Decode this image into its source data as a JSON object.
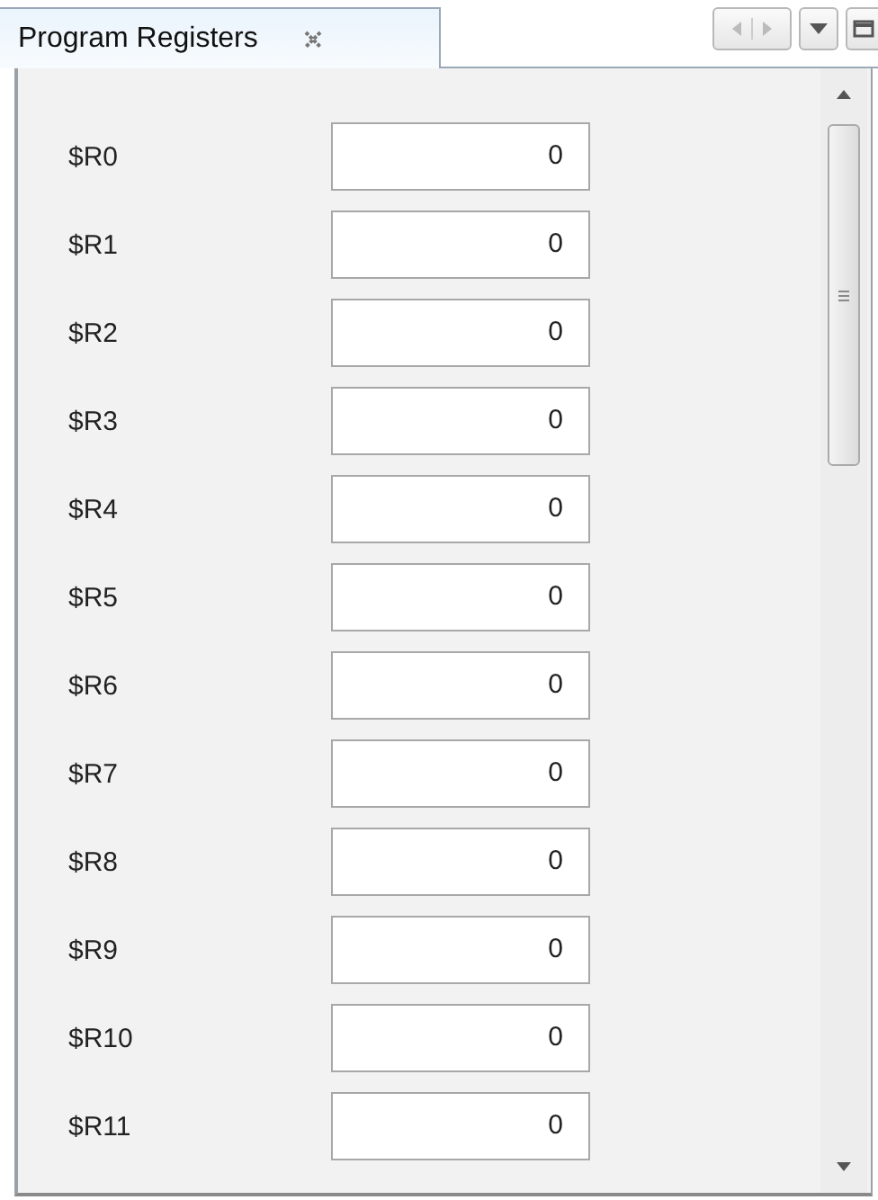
{
  "tab": {
    "title": "Program Registers",
    "selected": true
  },
  "registers": [
    {
      "name": "$R0",
      "value": "0"
    },
    {
      "name": "$R1",
      "value": "0"
    },
    {
      "name": "$R2",
      "value": "0"
    },
    {
      "name": "$R3",
      "value": "0"
    },
    {
      "name": "$R4",
      "value": "0"
    },
    {
      "name": "$R5",
      "value": "0"
    },
    {
      "name": "$R6",
      "value": "0"
    },
    {
      "name": "$R7",
      "value": "0"
    },
    {
      "name": "$R8",
      "value": "0"
    },
    {
      "name": "$R9",
      "value": "0"
    },
    {
      "name": "$R10",
      "value": "0"
    },
    {
      "name": "$R11",
      "value": "0"
    }
  ]
}
